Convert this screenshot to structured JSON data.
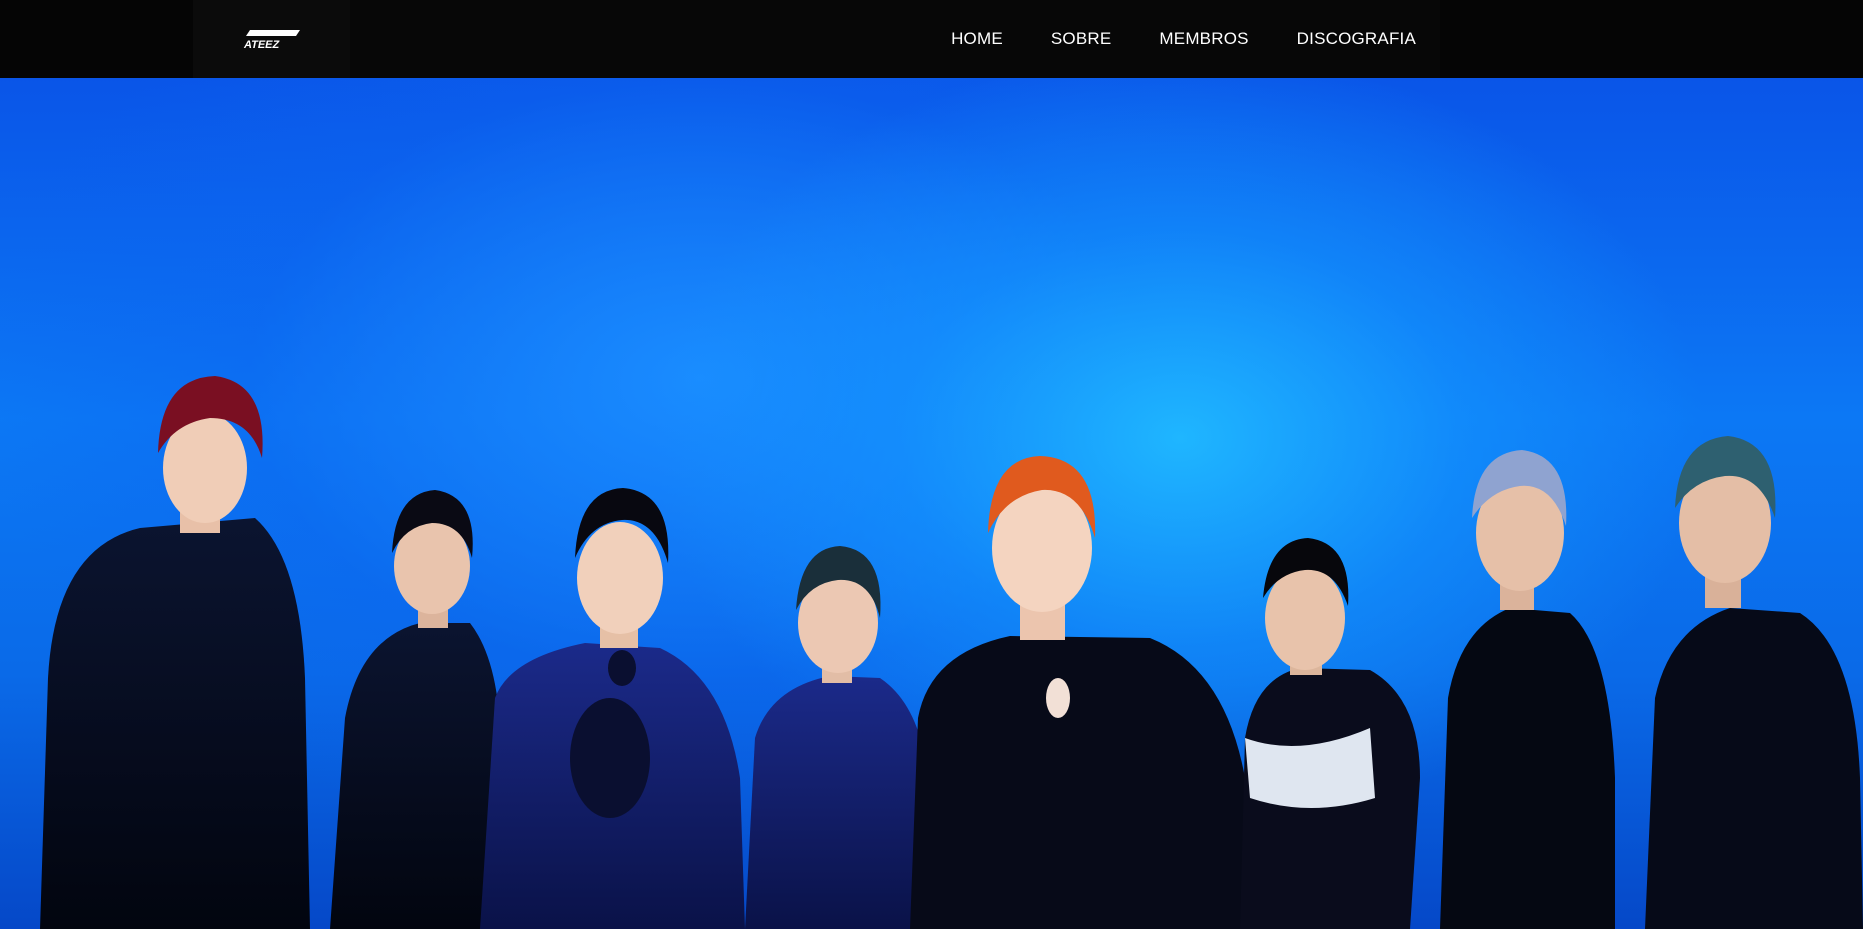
{
  "brand": {
    "logo_text": "ATEEZ"
  },
  "nav": {
    "items": [
      {
        "label": "HOME"
      },
      {
        "label": "SOBRE"
      },
      {
        "label": "MEMBROS"
      },
      {
        "label": "DISCOGRAFIA"
      }
    ]
  },
  "hero": {
    "background_color": "#0a6ae8"
  }
}
